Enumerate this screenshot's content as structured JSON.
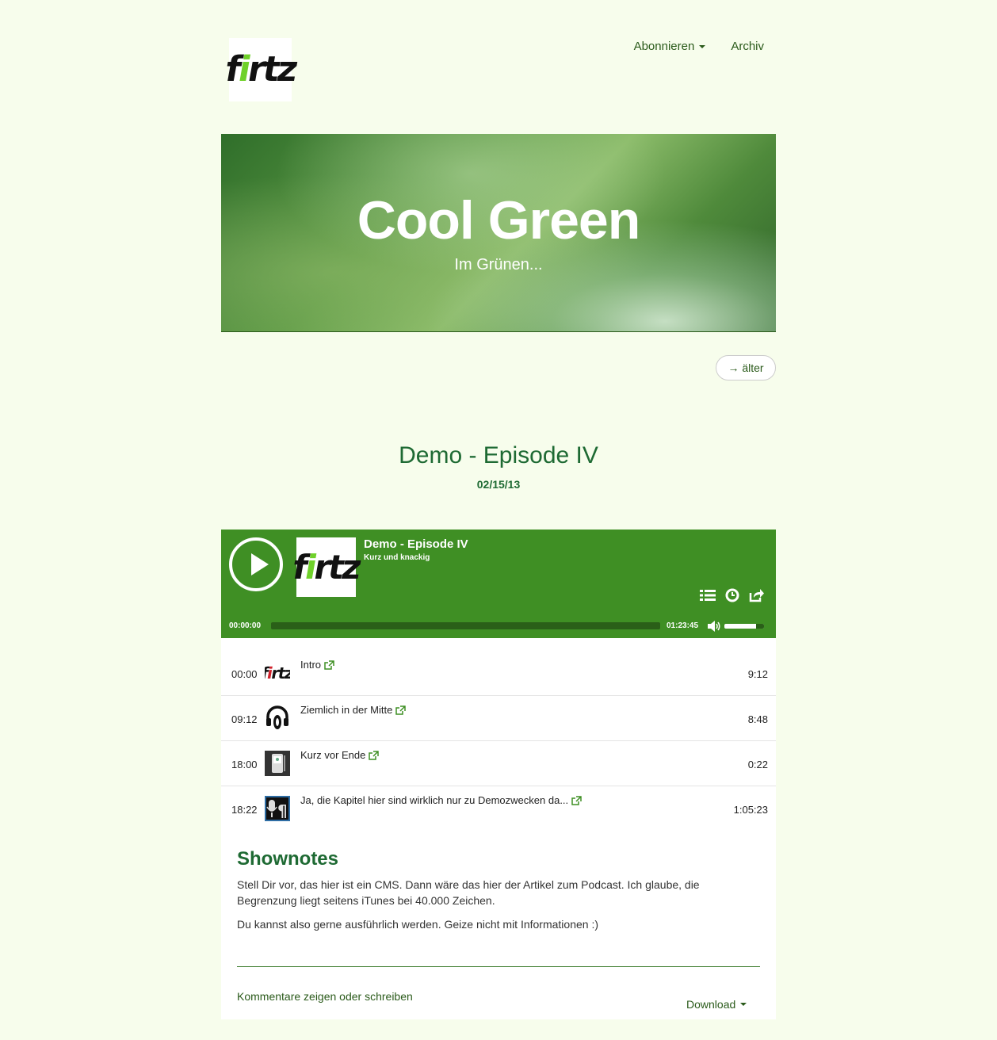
{
  "header": {
    "logo_text_pre": "f",
    "logo_text_green": "i",
    "logo_text_post": "rtz",
    "nav": {
      "subscribe": "Abonnieren",
      "archive": "Archiv"
    }
  },
  "banner": {
    "title": "Cool Green",
    "subtitle": "Im Grünen..."
  },
  "pager": {
    "older": "→ älter"
  },
  "episode": {
    "title": "Demo - Episode IV",
    "date": "02/15/13"
  },
  "player": {
    "title": "Demo - Episode IV",
    "subtitle": "Kurz und knackig",
    "time_current": "00:00:00",
    "time_total": "01:23:45",
    "progress": 0,
    "volume": 0.8
  },
  "chapters": [
    {
      "start": "00:00",
      "title": "Intro",
      "duration": "9:12",
      "icon": "fritz-logo-icon"
    },
    {
      "start": "09:12",
      "title": "Ziemlich in der Mitte",
      "duration": "8:48",
      "icon": "headphones-icon"
    },
    {
      "start": "18:00",
      "title": "Kurz vor Ende",
      "duration": "0:22",
      "icon": "device-icon"
    },
    {
      "start": "18:22",
      "title": "Ja, die Kapitel hier sind wirklich nur zu Demozwecken da...",
      "duration": "1:05:23",
      "icon": "mic-paragraph-icon"
    }
  ],
  "shownotes": {
    "heading": "Shownotes",
    "paragraph1": "Stell Dir vor, das hier ist ein CMS. Dann wäre das hier der Artikel zum Podcast. Ich glaube, die Begrenzung liegt seitens iTunes bei 40.000 Zeichen.",
    "paragraph2": "Du kannst also gerne ausführlich werden. Geize nicht mit Informationen :)",
    "comments_link": "Kommentare zeigen oder schreiben",
    "download": "Download"
  },
  "colors": {
    "background": "#f7fdec",
    "accent": "#3f8f24",
    "heading": "#1e6a33",
    "logo_green": "#6fd12a"
  }
}
